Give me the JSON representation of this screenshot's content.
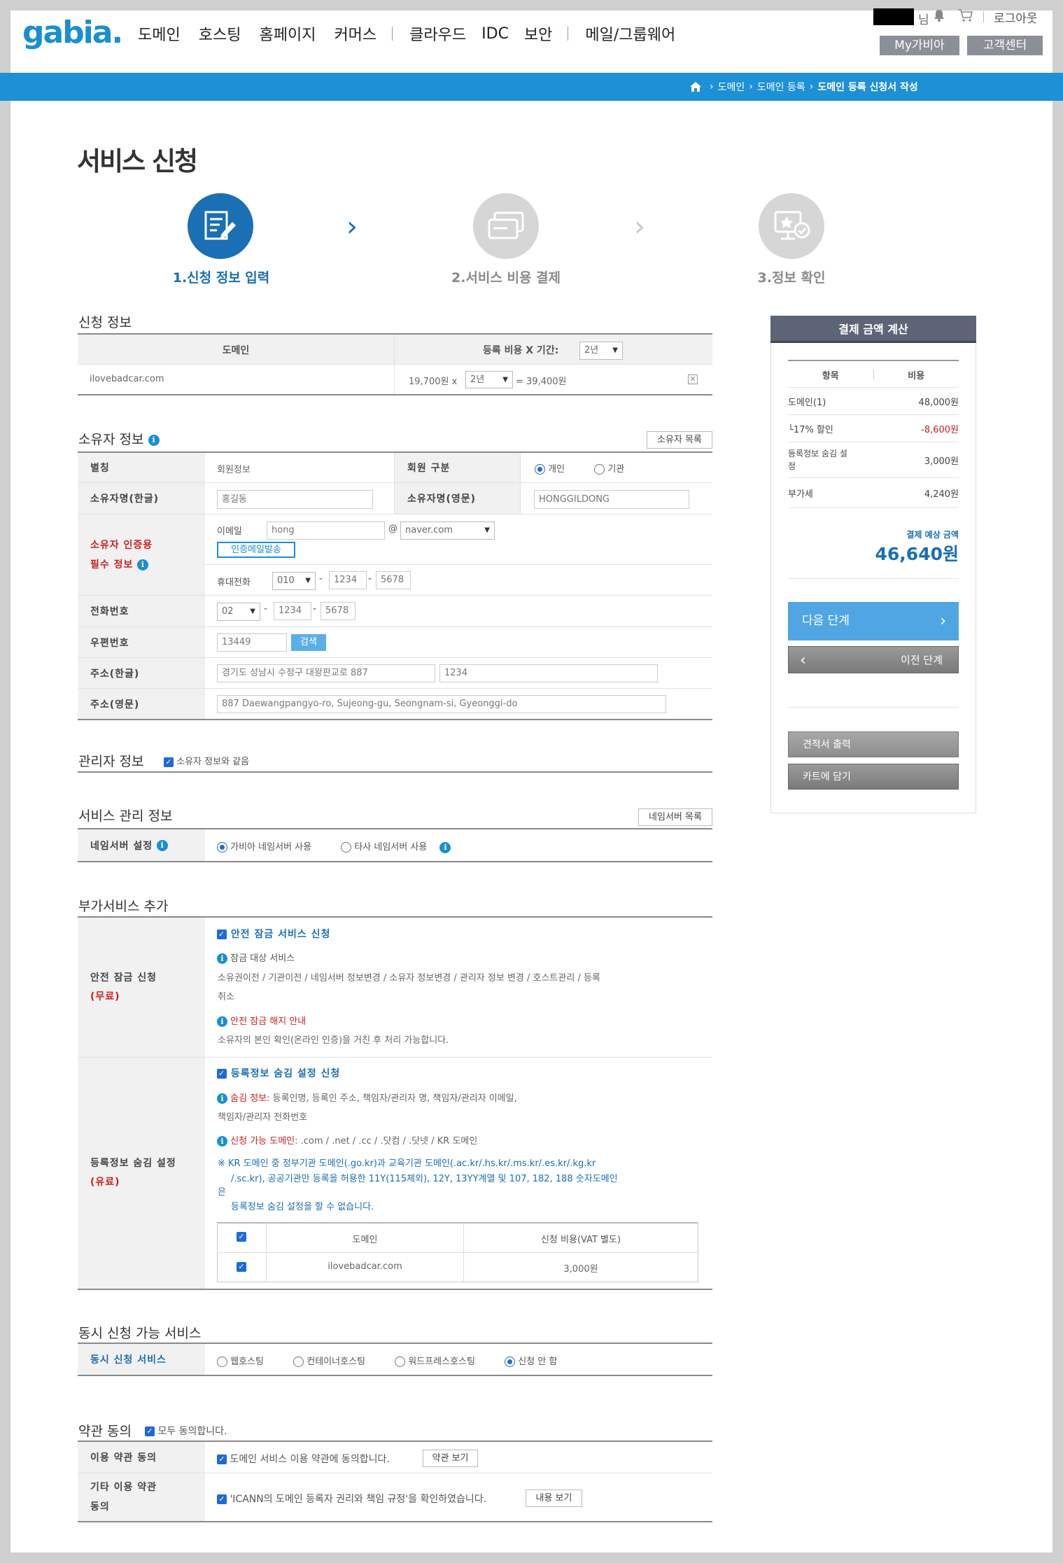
{
  "header": {
    "logo": "gabia.",
    "nav": [
      "도메인",
      "호스팅",
      "홈페이지",
      "커머스",
      "클라우드",
      "IDC",
      "보안",
      "메일/그룹웨어"
    ],
    "user_suffix": "님",
    "logout": "로그아웃",
    "my_gabia": "My가비아",
    "support": "고객센터"
  },
  "breadcrumb": {
    "items": [
      "도메인",
      "도메인 등록"
    ],
    "current": "도메인 등록 신청서 작성"
  },
  "page_title": "서비스 신청",
  "steps": [
    {
      "label": "1.신청 정보 입력"
    },
    {
      "label": "2.서비스 비용 결제"
    },
    {
      "label": "3.정보 확인"
    }
  ],
  "application": {
    "title": "신청 정보",
    "col_domain": "도메인",
    "col_cost": "등록 비용 X 기간:",
    "period": "2년",
    "domain": "ilovebadcar.com",
    "price": "19,700원 x",
    "row_period": "2년",
    "total": "= 39,400원"
  },
  "owner": {
    "title": "소유자 정보",
    "list_btn": "소유자 목록",
    "type_label": "별칭",
    "type_value": "회원정보",
    "member_label": "회원 구분",
    "individual": "개인",
    "org": "기관",
    "name_kr_label": "소유자명(한글)",
    "name_kr": "홍길동",
    "name_en_label": "소유자명(영문)",
    "name_en": "HONGGILDONG",
    "auth_label1": "소유자 인증용",
    "auth_label2": "필수 정보",
    "email_label": "이메일",
    "email_id": "hong",
    "email_at": "@",
    "email_domain": "naver.com",
    "send_mail": "인증메일발송",
    "mobile_label": "휴대전화",
    "mobile1": "010",
    "mobile2": "1234",
    "mobile3": "5678",
    "dash": "-",
    "phone_label": "전화번호",
    "phone1": "02",
    "phone2": "1234",
    "phone3": "5678",
    "zip_label": "우편번호",
    "zip": "13449",
    "search": "검색",
    "addr_kr_label": "주소(한글)",
    "addr_kr1": "경기도 성남시 수정구 대왕판교로 887",
    "addr_kr2": "1234",
    "addr_en_label": "주소(영문)",
    "addr_en": "887 Daewangpangyo-ro, Sujeong-gu, Seongnam-si, Gyeonggi-do"
  },
  "admin": {
    "title": "관리자 정보",
    "same": "소유자 정보와 같음"
  },
  "service_mgmt": {
    "title": "서비스 관리 정보",
    "ns_list": "네임서버 목록",
    "ns_label": "네임서버 설정",
    "opt1": "가비아 네임서버 사용",
    "opt2": "타사 네임서버 사용"
  },
  "addons": {
    "title": "부가서비스 추가",
    "lock_label1": "안전 잠금 신청",
    "lock_label2": "(무료)",
    "lock_check": "안전 잠금 서비스 신청",
    "lock_target": "잠금 대상 서비스",
    "lock_desc1": "소유권이전 / 기관이전 / 네임서버 정보변경 / 소유자 정보변경 / 관리자 정보 변경 / 호스트관리 / 등록",
    "lock_desc2": "취소",
    "lock_release": "안전 잠금 해지 안내",
    "lock_release_desc": "소유자의 본인 확인(온라인 인증)을 거친 후 처리 가능합니다.",
    "hide_label1": "등록정보 숨김 설정",
    "hide_label2": "(유료)",
    "hide_check": "등록정보 숨김 설정 신청",
    "hide_info_k": "숨김 정보",
    "hide_info_v": ": 등록인명, 등록인 주소, 책임자/관리자 명, 책임자/관리자 이메일,",
    "hide_info_v2": "책임자/관리자 전화번호",
    "hide_avail_k": "신청 가능 도메인",
    "hide_avail_v": ": .com / .net / .cc / .닷컴 / .닷넷 / KR 도메인",
    "note1": "※ KR 도메인 중 정부기관 도메인(.go.kr)과 교육기관 도메인(.ac.kr/.hs.kr/.ms.kr/.es.kr/.kg.kr",
    "note2": "/.sc.kr), 공공기관만 등록을 허용한 11Y(115체외), 12Y, 13YY계열 및 107, 182, 188 숫자도메인",
    "note3": "은",
    "note4": "등록정보 숨김 설정을 할 수 없습니다.",
    "table_col1": "도메인",
    "table_col2": "신청 비용(VAT 별도)",
    "table_domain": "ilovebadcar.com",
    "table_cost": "3,000원"
  },
  "concurrent": {
    "title": "동시 신청 가능 서비스",
    "label": "동시 신청 서비스",
    "opts": [
      "웹호스팅",
      "컨테이너호스팅",
      "워드프레스호스팅",
      "신청 안 함"
    ]
  },
  "terms": {
    "title": "약관 동의",
    "all": "모두 동의합니다.",
    "use_label": "이용 약관 동의",
    "use_text": "도메인 서비스 이용 약관에 동의합니다.",
    "use_btn": "약관 보기",
    "other_label1": "기타 이용 약관",
    "other_label2": "동의",
    "other_text": "'ICANN의 도메인 등록자 권리와 책임 규정'을 확인하였습니다.",
    "other_btn": "내용 보기"
  },
  "sidebar": {
    "title": "결제 금액 계산",
    "col_item": "항목",
    "col_cost": "비용",
    "rows": [
      {
        "label": "도메인(1)",
        "value": "48,000원"
      },
      {
        "label": "└17% 할인",
        "value": "-8,600원"
      },
      {
        "label": "등록정보 숨김 설정",
        "value": "3,000원"
      },
      {
        "label": "부가세",
        "value": "4,240원"
      }
    ],
    "expected_label": "결제 예상 금액",
    "expected": "46,640원",
    "next": "다음 단계",
    "prev": "이전 단계",
    "estimate": "견적서 출력",
    "cart": "카트에 담기"
  },
  "colors": {
    "brand": "#1a8fd0",
    "blue_bar": "#1e90d6",
    "dark_header": "#5c6476"
  }
}
